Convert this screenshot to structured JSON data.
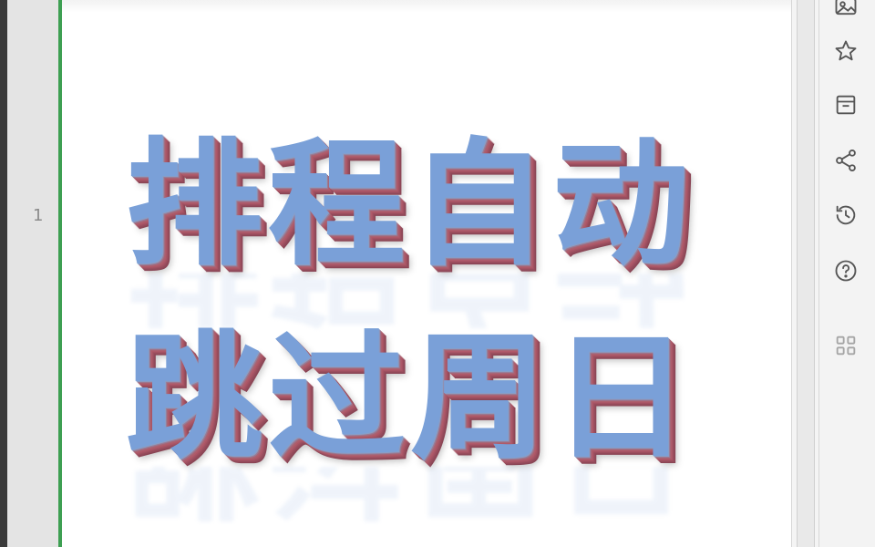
{
  "spreadsheet": {
    "row_number": "1",
    "word_art": {
      "line1": "排程自动",
      "line2": "跳过周日"
    }
  },
  "sidebar": {
    "icons": [
      "image-icon",
      "star-icon",
      "archive-icon",
      "share-icon",
      "history-icon",
      "help-icon",
      "grid-icon"
    ]
  },
  "colors": {
    "text_face": "#7aa0d8",
    "text_bevel": "#a86573",
    "accent_green": "#3d9f52"
  }
}
